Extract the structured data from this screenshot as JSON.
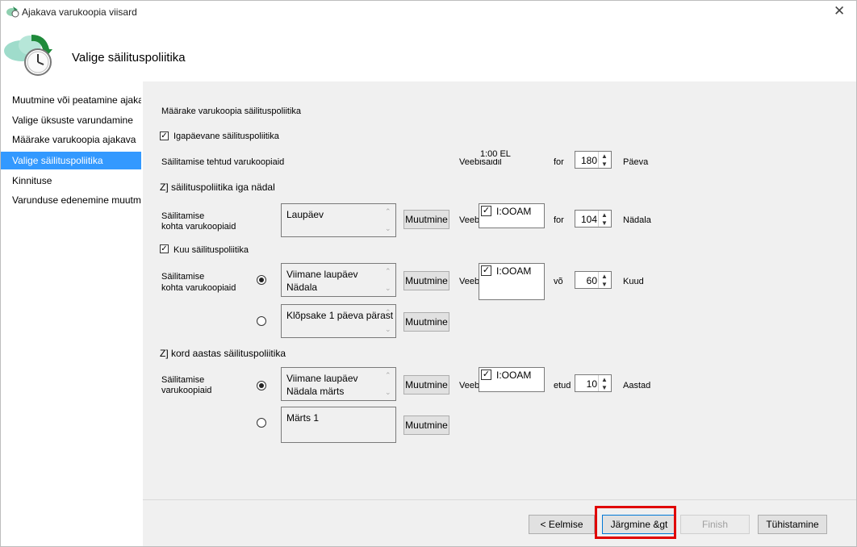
{
  "window": {
    "title": "Ajakava varukoopia viisard",
    "close_glyph": "✕"
  },
  "header": {
    "title": "Valige säilituspoliitika",
    "icon": "cloud-clock-icon"
  },
  "sidebar": {
    "items": [
      {
        "label": "Muutmine või peatamine ajakava"
      },
      {
        "label": "Valige üksuste varundamine"
      },
      {
        "label": "Määrake varukoopia ajakava"
      },
      {
        "label": "Valige säilituspoliitika",
        "selected": true
      },
      {
        "label": "Kinnituse"
      },
      {
        "label": "Varunduse edenemine muutmine"
      }
    ]
  },
  "main": {
    "heading": "Määrake varukoopia säilituspoliitika",
    "daily": {
      "checkbox_label": "Igapäevane säilituspoliitika",
      "checked": true,
      "row_label": "Säilitamise tehtud varukoopiaid",
      "time_text": "1:00 EL",
      "at_label": "Veebisaidil",
      "for_label": "for",
      "value": "180",
      "unit": "Päeva"
    },
    "weekly": {
      "section_title": "Z] säilituspoliitika iga nädal",
      "row_label_1": "Säilitamise",
      "row_label_2": "kohta varukoopiaid",
      "list_text": "Laupäev",
      "modify_label": "Muutmine",
      "at_label": "Veebisaidil",
      "time_text": "I:OOAM",
      "for_label": "for",
      "value": "104",
      "unit": "Nädala"
    },
    "monthly": {
      "checkbox_label": "Kuu säilituspoliitika",
      "checked": true,
      "row_label_1": "Säilitamise",
      "row_label_2": "kohta varukoopiaid",
      "option1_text": "Viimane laupäev\nNädala",
      "option2_text": "Klõpsake 1 päeva pärast",
      "option1_selected": true,
      "modify_label": "Muutmine",
      "at_label": "Veebisaidil",
      "time_text": "I:OOAM",
      "for_label": "võ",
      "value": "60",
      "unit": "Kuud"
    },
    "yearly": {
      "section_title": "Z] kord aastas säilituspoliitika",
      "row_label_1": "Säilitamise",
      "row_label_2": "varukoopiaid",
      "option1_text": "Viimane laupäev\nNädala märts",
      "option2_text": "Märts 1",
      "option1_selected": true,
      "modify_label": "Muutmine",
      "at_label": "Veebisaidil",
      "time_text": "I:OOAM",
      "for_label": "etud",
      "value": "10",
      "unit": "Aastad"
    }
  },
  "footer": {
    "back_label": "< Eelmise",
    "next_label": "Järgmine &gt",
    "finish_label": "Finish",
    "cancel_label": "Tühistamine"
  },
  "colors": {
    "selection": "#3399ff",
    "highlight": "#e00000",
    "panel": "#f0f0f0"
  }
}
